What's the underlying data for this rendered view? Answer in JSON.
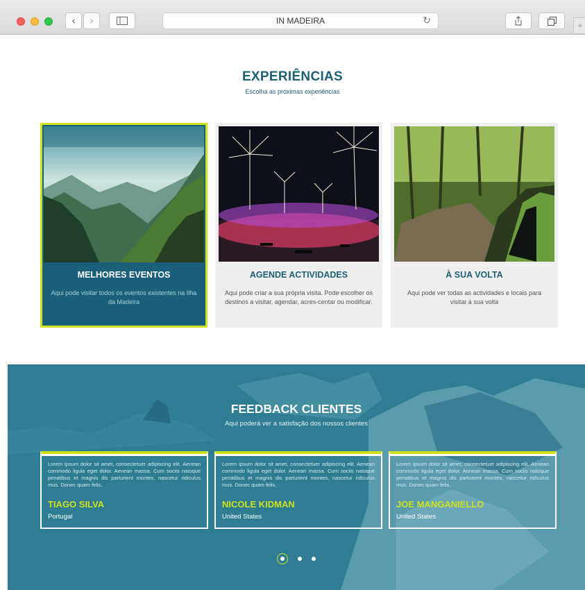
{
  "browser": {
    "address": "IN MADEIRA",
    "back_icon": "chevron-left-icon",
    "forward_icon": "chevron-right-icon",
    "sidebar_icon": "sidebar-icon",
    "reload_icon": "reload-icon",
    "share_icon": "share-icon",
    "tabs_icon": "tabs-icon",
    "new_tab": "+"
  },
  "experiences": {
    "title": "EXPERIÊNCIAS",
    "subtitle": "Escolha as próximas experiências",
    "cards": [
      {
        "title": "MELHORES EVENTOS",
        "description": "Aqui pode visitar todos os eventos existentes na Ilha da Madeira",
        "image": "mountain-valley-image",
        "active": true
      },
      {
        "title": "AGENDE ACTIVIDADES",
        "description": "Aqui pode criar a sua própria visita. Pode escolher os destinos a visitar, agendar, acres-centar ou modificar.",
        "image": "fireworks-image",
        "active": false
      },
      {
        "title": "À SUA VOLTA",
        "description": "Aqui pode ver todas as actividades e locais para visitar à sua volta",
        "image": "forest-levada-image",
        "active": false
      }
    ]
  },
  "feedback": {
    "title": "FEEDBACK CLIENTES",
    "subtitle": "Aqui poderá ver a satisfação dos nossos clientes",
    "testimonials": [
      {
        "text": "Lorem ipsum dolor sit amet, consectetuer adipiscing elit. Aenean commodo ligula eget dolor. Aenean massa. Cum sociis natoque penatibus et magnis dis parturient montes, nascetur ridiculus mus. Donec quam felis,",
        "name": "TIAGO SILVA",
        "country": "Portugal"
      },
      {
        "text": "Lorem ipsum dolor sit amet, consectetuer adipiscing elit. Aenean commodo ligula eget dolor. Aenean massa. Cum sociis natoque penatibus et magnis dis parturient montes, nascetur ridiculus mus. Donec quam felis,",
        "name": "NICOLE KIDMAN",
        "country": "United States"
      },
      {
        "text": "Lorem ipsum dolor sit amet, consectetuer adipiscing elit. Aenean commodo ligula eget dolor. Aenean massa. Cum sociis natoque penatibus et magnis dis parturient montes, nascetur ridiculus mus. Donec quam felis,",
        "name": "JOE MANGANIELLO",
        "country": "United States"
      }
    ],
    "pager": {
      "pages": 3,
      "current": 1
    }
  },
  "colors": {
    "primary": "#1d5f73",
    "accent": "#cfe11e",
    "feedback_bg": "#2f7d92",
    "card_bg": "#efefef"
  }
}
